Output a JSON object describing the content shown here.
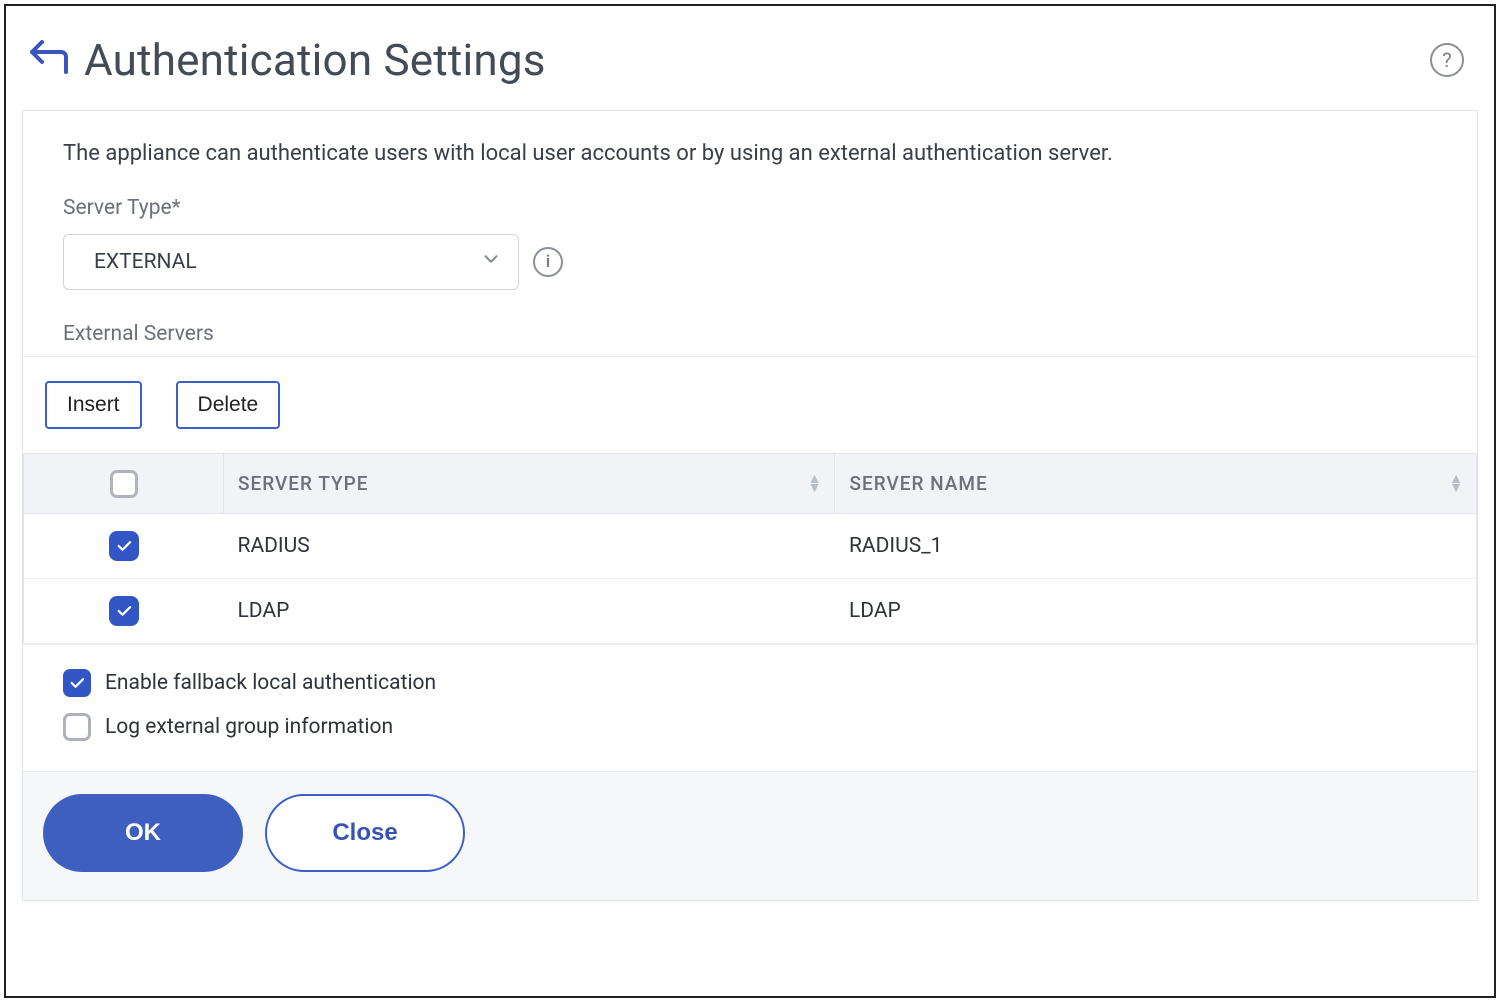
{
  "header": {
    "title": "Authentication Settings"
  },
  "panel": {
    "description": "The appliance can authenticate users with local user accounts or by using an external authentication server.",
    "serverTypeLabel": "Server Type*",
    "serverTypeValue": "EXTERNAL",
    "externalServersLabel": "External Servers"
  },
  "toolbar": {
    "insert": "Insert",
    "delete": "Delete"
  },
  "table": {
    "columns": {
      "serverType": "SERVER TYPE",
      "serverName": "SERVER NAME"
    },
    "rows": [
      {
        "checked": true,
        "serverType": "RADIUS",
        "serverName": "RADIUS_1"
      },
      {
        "checked": true,
        "serverType": "LDAP",
        "serverName": "LDAP"
      }
    ]
  },
  "options": {
    "fallback": {
      "checked": true,
      "label": "Enable fallback local authentication"
    },
    "logGroup": {
      "checked": false,
      "label": "Log external group information"
    }
  },
  "footer": {
    "ok": "OK",
    "close": "Close"
  }
}
